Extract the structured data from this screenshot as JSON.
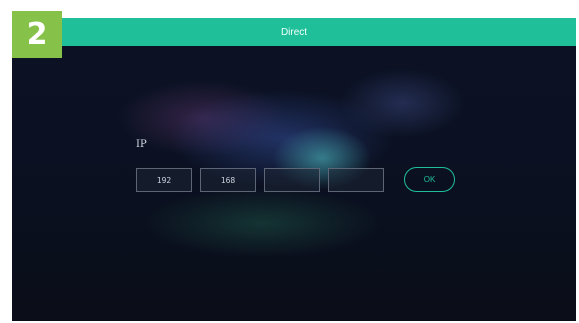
{
  "step_badge": "2",
  "header": {
    "title": "Direct"
  },
  "form": {
    "ip_label": "IP",
    "octets": [
      "192",
      "168",
      "",
      ""
    ],
    "ok_label": "OK"
  },
  "colors": {
    "accent": "#1fbf9a",
    "badge": "#86c24a",
    "background": "#0b1122"
  }
}
